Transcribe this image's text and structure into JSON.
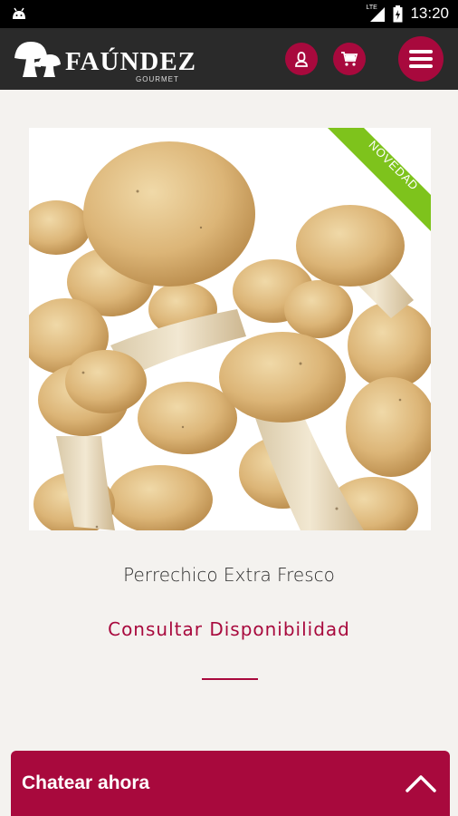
{
  "status_bar": {
    "time": "13:20",
    "network": "LTE",
    "icons": [
      "android-icon",
      "signal-icon",
      "battery-icon"
    ]
  },
  "header": {
    "brand": "FAÚNDEZ",
    "brand_sub": "GOURMET",
    "icons": [
      "user-icon",
      "cart-icon",
      "menu-icon"
    ],
    "accent_color": "#a8093d",
    "background_color": "#2a2a2a"
  },
  "product": {
    "ribbon": "NOVEDAD",
    "ribbon_color": "#7ec31c",
    "title": "Perrechico Extra Fresco",
    "availability": "Consultar Disponibilidad"
  },
  "chat": {
    "label": "Chatear ahora",
    "icon": "chevron-up-icon"
  }
}
